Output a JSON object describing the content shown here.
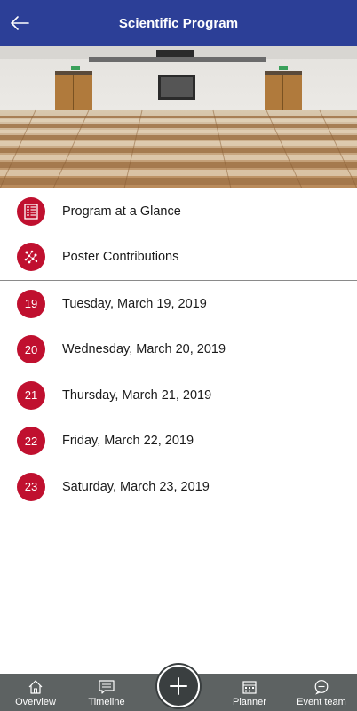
{
  "header": {
    "title": "Scientific Program"
  },
  "menu": [
    {
      "label": "Program at a Glance",
      "icon": "schedule-grid-icon"
    },
    {
      "label": "Poster Contributions",
      "icon": "poster-network-icon"
    }
  ],
  "days": [
    {
      "num": "19",
      "label": "Tuesday, March 19, 2019"
    },
    {
      "num": "20",
      "label": "Wednesday, March 20, 2019"
    },
    {
      "num": "21",
      "label": "Thursday, March 21, 2019"
    },
    {
      "num": "22",
      "label": "Friday, March 22, 2019"
    },
    {
      "num": "23",
      "label": "Saturday, March 23, 2019"
    }
  ],
  "tabs": {
    "overview": "Overview",
    "timeline": "Timeline",
    "planner": "Planner",
    "event_team": "Event team"
  },
  "colors": {
    "header": "#2c3f97",
    "accent": "#c0102f",
    "tabbar": "#5d6262"
  }
}
